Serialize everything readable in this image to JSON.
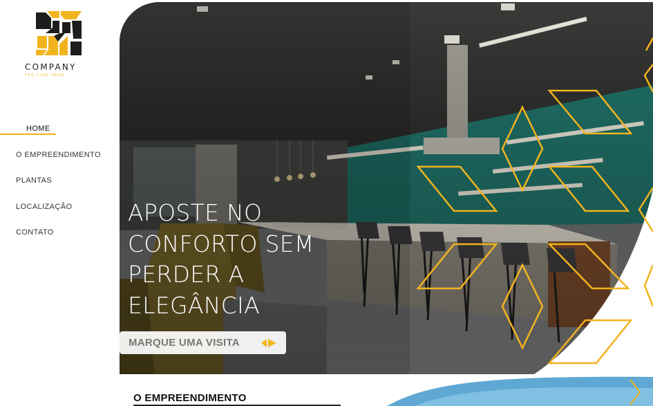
{
  "brand": {
    "name": "COMPANY",
    "tagline": "TAG LINE HERE",
    "primary_color": "#f2b41e",
    "dark_color": "#1d1d1b"
  },
  "nav": {
    "items": [
      {
        "label": "HOME",
        "active": true
      },
      {
        "label": "O EMPREENDIMENTO",
        "active": false
      },
      {
        "label": "PLANTAS",
        "active": false
      },
      {
        "label": "LOCALIZAÇÃO",
        "active": false
      },
      {
        "label": "CONTATO",
        "active": false
      }
    ]
  },
  "hero": {
    "headline_lines": [
      "APOSTE NO",
      "CONFORTO SEM",
      "PERDER A",
      "ELEGÂNCIA"
    ],
    "cta_label": "MARQUE UMA VISITA",
    "cta_icon": "double-chevron-icon"
  },
  "section": {
    "title": "O EMPREENDIMENTO"
  }
}
